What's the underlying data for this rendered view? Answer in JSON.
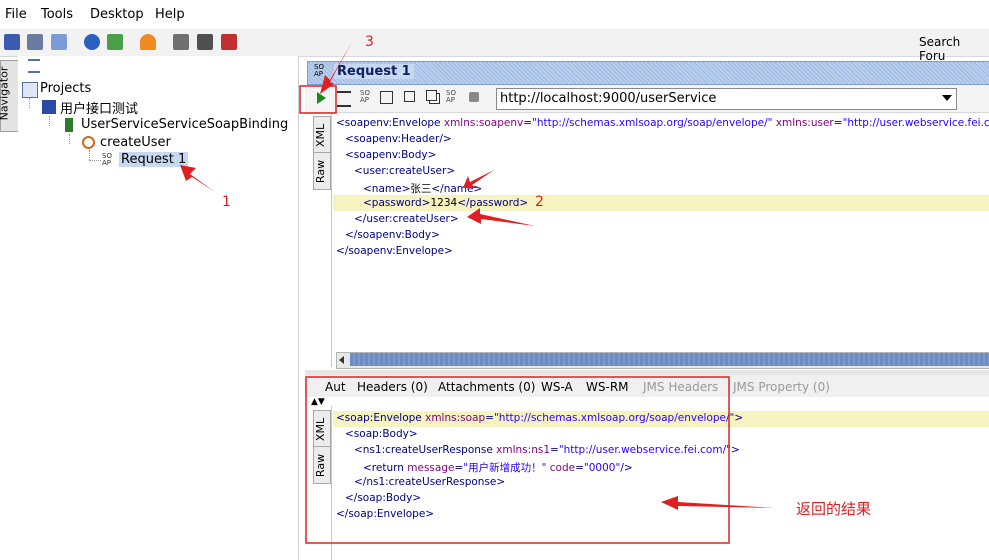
{
  "menu": [
    "File",
    "Tools",
    "Desktop",
    "Help"
  ],
  "search_label": "Search Foru",
  "navigator_label": "Navigator",
  "tree": {
    "root": "Projects",
    "project": "用户接口测试",
    "binding": "UserServiceServiceSoapBinding",
    "operation": "createUser",
    "request": "Request 1"
  },
  "request_window": {
    "title": "Request 1",
    "url": "http://localhost:9000/userService",
    "side_tabs": [
      "XML",
      "Raw"
    ],
    "xml_lines": [
      {
        "indent": 0,
        "parts": [
          [
            "tag",
            "<soapenv:Envelope "
          ],
          [
            "attr",
            "xmlns:soapenv"
          ],
          [
            "tag",
            "="
          ],
          [
            "val",
            "\"http://schemas.xmlsoap.org/soap/envelope/\""
          ],
          [
            "tag",
            " "
          ],
          [
            "attr",
            "xmlns:user"
          ],
          [
            "tag",
            "="
          ],
          [
            "val",
            "\"http://user.webservice.fei.com/\""
          ],
          [
            "tag",
            ">"
          ]
        ]
      },
      {
        "indent": 1,
        "parts": [
          [
            "tag",
            "<soapenv:Header/>"
          ]
        ]
      },
      {
        "indent": 1,
        "parts": [
          [
            "tag",
            "<soapenv:Body>"
          ]
        ]
      },
      {
        "indent": 2,
        "parts": [
          [
            "tag",
            "<user:createUser>"
          ]
        ]
      },
      {
        "indent": 3,
        "parts": [
          [
            "tag",
            "<name>"
          ],
          [
            "txt",
            "张三"
          ],
          [
            "tag",
            "</name>"
          ]
        ]
      },
      {
        "indent": 3,
        "parts": [
          [
            "tag",
            "<password>"
          ],
          [
            "txt",
            "1234"
          ],
          [
            "tag",
            "</password>"
          ]
        ]
      },
      {
        "indent": 2,
        "parts": [
          [
            "tag",
            "</user:createUser>"
          ]
        ]
      },
      {
        "indent": 1,
        "parts": [
          [
            "tag",
            "</soapenv:Body>"
          ]
        ]
      },
      {
        "indent": 0,
        "parts": [
          [
            "tag",
            "</soapenv:Envelope>"
          ]
        ]
      }
    ]
  },
  "response_tabs": [
    {
      "label": "Aut",
      "enabled": true
    },
    {
      "label": "Headers (0)",
      "enabled": true
    },
    {
      "label": "Attachments (0)",
      "enabled": true
    },
    {
      "label": "WS-A",
      "enabled": true
    },
    {
      "label": "WS-RM",
      "enabled": true
    },
    {
      "label": "JMS Headers",
      "enabled": false
    },
    {
      "label": "JMS Property (0)",
      "enabled": false
    }
  ],
  "response": {
    "side_tabs": [
      "XML",
      "Raw"
    ],
    "xml_lines": [
      {
        "indent": 0,
        "parts": [
          [
            "tag",
            "<soap:Envelope "
          ],
          [
            "attr",
            "xmlns:soap"
          ],
          [
            "tag",
            "="
          ],
          [
            "val",
            "\"http://schemas.xmlsoap.org/soap/envelope/\""
          ],
          [
            "tag",
            ">"
          ]
        ]
      },
      {
        "indent": 1,
        "parts": [
          [
            "tag",
            "<soap:Body>"
          ]
        ]
      },
      {
        "indent": 2,
        "parts": [
          [
            "tag",
            "<ns1:createUserResponse "
          ],
          [
            "attr",
            "xmlns:ns1"
          ],
          [
            "tag",
            "="
          ],
          [
            "val",
            "\"http://user.webservice.fei.com/\""
          ],
          [
            "tag",
            ">"
          ]
        ]
      },
      {
        "indent": 3,
        "parts": [
          [
            "tag",
            "<return "
          ],
          [
            "attr",
            "message"
          ],
          [
            "tag",
            "="
          ],
          [
            "val",
            "\"用户新增成功！\""
          ],
          [
            "tag",
            " "
          ],
          [
            "attr",
            "code"
          ],
          [
            "tag",
            "="
          ],
          [
            "val",
            "\"0000\""
          ],
          [
            "tag",
            "/>"
          ]
        ]
      },
      {
        "indent": 2,
        "parts": [
          [
            "tag",
            "</ns1:createUserResponse>"
          ]
        ]
      },
      {
        "indent": 1,
        "parts": [
          [
            "tag",
            "</soap:Body>"
          ]
        ]
      },
      {
        "indent": 0,
        "parts": [
          [
            "tag",
            "</soap:Envelope>"
          ]
        ]
      }
    ]
  },
  "annotations": {
    "n1": "1",
    "n2": "2",
    "n3": "3",
    "result_label": "返回的结果"
  },
  "colors": {
    "annotation": "#e02020",
    "tab_blue": "#a9c2e6",
    "selected_node": "#c5d9f1",
    "highlight_line": "#f7f3c0",
    "run_green": "#1a8a1a"
  }
}
